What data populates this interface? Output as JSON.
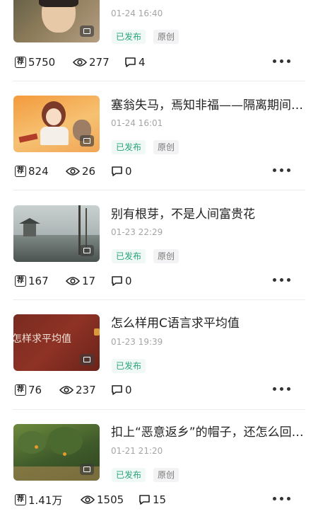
{
  "articles": [
    {
      "title": "",
      "time": "01-24 16:40",
      "status": "已发布",
      "original": "原创",
      "rec_icon_text": "荐",
      "recommendations": "5750",
      "views": "277",
      "comments": "4",
      "thumb_colors": [
        "#5d5a45",
        "#8a7a58",
        "#b59e82"
      ]
    },
    {
      "title": "塞翁失马，焉知非福——隔离期间…",
      "time": "01-24 16:01",
      "status": "已发布",
      "original": "原创",
      "rec_icon_text": "荐",
      "recommendations": "824",
      "views": "26",
      "comments": "0",
      "thumb_colors": [
        "#f39a3b",
        "#f6c172",
        "#7c3a28"
      ]
    },
    {
      "title": "别有根芽，不是人间富贵花",
      "time": "01-23 22:29",
      "status": "已发布",
      "original": "原创",
      "rec_icon_text": "荐",
      "recommendations": "167",
      "views": "17",
      "comments": "0",
      "thumb_colors": [
        "#9aa7a8",
        "#c9d0d0",
        "#4b5350"
      ]
    },
    {
      "title": "怎么样用C语言求平均值",
      "time": "01-23 19:39",
      "status": "已发布",
      "original": "",
      "thumb_text": "怎样求平均值",
      "rec_icon_text": "荐",
      "recommendations": "76",
      "views": "237",
      "comments": "0",
      "thumb_colors": [
        "#7a2b20",
        "#8e3225",
        "#6a231a"
      ]
    },
    {
      "title": "扣上“恶意返乡”的帽子，还怎么回…",
      "time": "01-21 21:20",
      "status": "已发布",
      "original": "原创",
      "rec_icon_text": "荐",
      "recommendations": "1.41万",
      "views": "1505",
      "comments": "15",
      "thumb_colors": [
        "#3f5a2a",
        "#6d8a3c",
        "#b78e56"
      ]
    }
  ]
}
